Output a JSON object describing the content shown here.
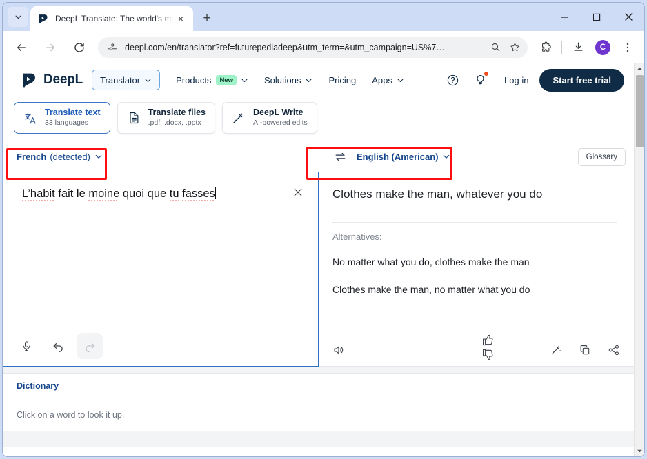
{
  "browser": {
    "tab": {
      "title": "DeepL Translate: The world's mo",
      "favicon_name": "deepl-favicon",
      "close_label": "×",
      "new_tab_label": "+"
    },
    "tab_list_icon": "chevron-down-icon",
    "window_controls": {
      "minimize": "–",
      "maximize": "□",
      "close": "✕"
    },
    "toolbar": {
      "back": "back-arrow-icon",
      "forward": "forward-arrow-icon",
      "reload": "reload-icon",
      "site_settings_icon": "tune-icon",
      "url": "deepl.com/en/translator?ref=futurepediadeep&utm_term=&utm_campaign=US%7…",
      "zoom_icon": "search-minus-icon",
      "bookmark_icon": "star-icon",
      "extensions_icon": "puzzle-icon",
      "downloads_icon": "download-icon",
      "profile_initial": "C",
      "menu_icon": "three-dots-icon"
    }
  },
  "site": {
    "logo_text": "DeepL",
    "product_pill": "Translator",
    "nav": [
      {
        "label": "Products",
        "badge": "New",
        "caret": true
      },
      {
        "label": "Solutions",
        "badge": "",
        "caret": true
      },
      {
        "label": "Pricing",
        "badge": "",
        "caret": false
      },
      {
        "label": "Apps",
        "badge": "",
        "caret": true
      }
    ],
    "help_icon": "question-circle-icon",
    "ideas_icon": "lightbulb-icon",
    "login": "Log in",
    "cta": "Start free trial"
  },
  "modes": [
    {
      "title": "Translate text",
      "subtitle": "33 languages",
      "icon": "translate-icon",
      "active": true
    },
    {
      "title": "Translate files",
      "subtitle": ".pdf, .docx, .pptx",
      "icon": "document-icon",
      "active": false
    },
    {
      "title": "DeepL Write",
      "subtitle": "AI-powered edits",
      "icon": "magic-wand-icon",
      "active": false
    }
  ],
  "language_bar": {
    "source_language": "French",
    "source_detected": "(detected)",
    "target_language": "English (American)",
    "swap_icon": "swap-arrows-icon",
    "glossary": "Glossary"
  },
  "source_panel": {
    "text_segments": [
      {
        "text": "L’habit",
        "misspelled": true
      },
      {
        "text": " fait le ",
        "misspelled": false
      },
      {
        "text": "moine",
        "misspelled": true
      },
      {
        "text": " quoi que ",
        "misspelled": false
      },
      {
        "text": "tu",
        "misspelled": true
      },
      {
        "text": " ",
        "misspelled": false
      },
      {
        "text": "fasses",
        "misspelled": true
      }
    ],
    "full_text": "L’habit fait le moine quoi que tu fasses",
    "clear_icon": "close-icon",
    "tools": [
      {
        "name": "microphone-icon",
        "disabled": false
      },
      {
        "name": "undo-icon",
        "disabled": false
      },
      {
        "name": "redo-icon",
        "disabled": true
      }
    ]
  },
  "target_panel": {
    "translation": "Clothes make the man, whatever you do",
    "alternatives_label": "Alternatives:",
    "alternatives": [
      "No matter what you do, clothes make the man",
      "Clothes make the man, no matter what you do"
    ],
    "tools": {
      "speaker": "speaker-icon",
      "thumbs_up": "thumbs-up-icon",
      "thumbs_down": "thumbs-down-icon",
      "improve": "magic-wand-icon",
      "copy": "copy-icon",
      "share": "share-icon"
    }
  },
  "dictionary": {
    "title": "Dictionary",
    "hint": "Click on a word to look it up."
  },
  "colors": {
    "highlight": "#fd0d0d",
    "brand_navy": "#0f2b46",
    "link_blue": "#14458c",
    "focus_border": "#2f6fc4",
    "badge_green": "#9df2c8",
    "avatar_purple": "#6f35cf"
  }
}
